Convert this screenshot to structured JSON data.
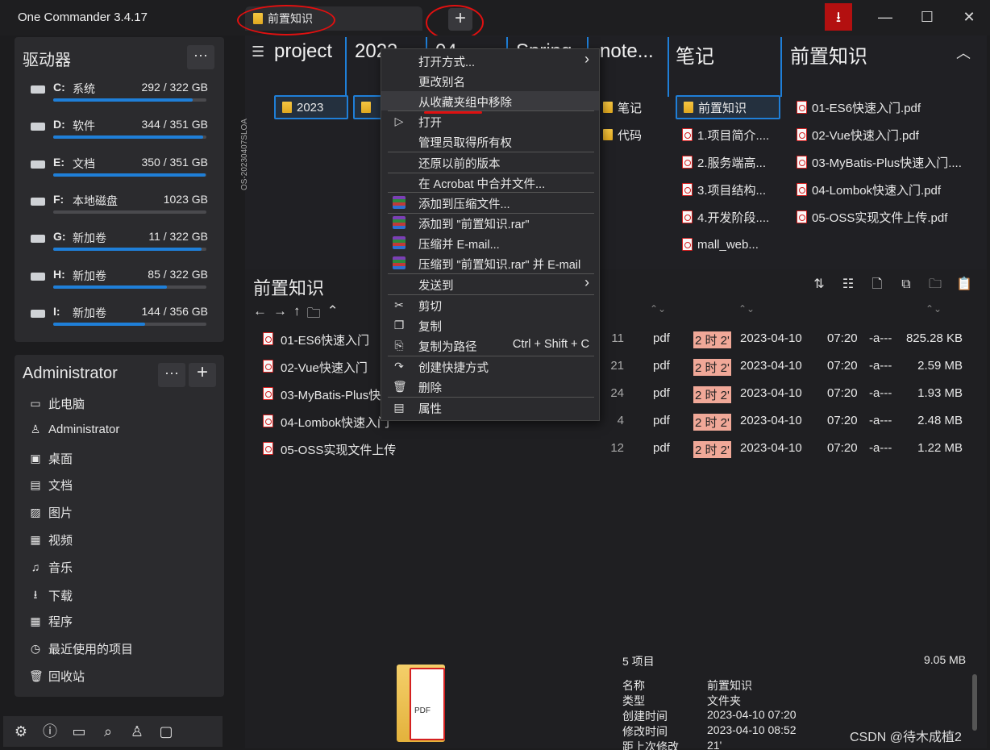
{
  "app": {
    "title": "One Commander 3.4.17"
  },
  "tab": {
    "label": "前置知识",
    "new_tab": "+"
  },
  "window": {
    "download": "⭳",
    "minimize": "—",
    "maximize": "☐",
    "close": "✕"
  },
  "drives_panel": {
    "title": "驱动器",
    "more": "···",
    "drives": [
      {
        "letter": "C:",
        "name": "系统",
        "used": "292",
        "total": "322 GB",
        "fill": 0.91
      },
      {
        "letter": "D:",
        "name": "软件",
        "used": "344",
        "total": "351 GB",
        "fill": 0.98
      },
      {
        "letter": "E:",
        "name": "文档",
        "used": "350",
        "total": "351 GB",
        "fill": 0.997
      },
      {
        "letter": "F:",
        "name": "本地磁盘",
        "used": "1023",
        "total": "GB",
        "fill": 0
      },
      {
        "letter": "G:",
        "name": "新加卷",
        "used": "11",
        "total": "322 GB",
        "fill": 0.97
      },
      {
        "letter": "H:",
        "name": "新加卷",
        "used": "85",
        "total": "322 GB",
        "fill": 0.74
      },
      {
        "letter": "I:",
        "name": "新加卷",
        "used": "144",
        "total": "356 GB",
        "fill": 0.6
      }
    ]
  },
  "admin_panel": {
    "title": "Administrator",
    "more": "···",
    "add": "+",
    "items": [
      "此电脑",
      "Administrator",
      "桌面",
      "文档",
      "图片",
      "视频",
      "音乐",
      "下载",
      "程序",
      "最近使用的项目",
      "回收站"
    ]
  },
  "columns": {
    "titles": [
      "project",
      "2023",
      "04",
      "Spring",
      "note...",
      "笔记",
      "前置知识"
    ],
    "col1_items": [
      "2023"
    ],
    "col5_items": [
      "笔记",
      "代码"
    ],
    "col6_items": [
      "前置知识",
      "1.项目简介....",
      "2.服务端高...",
      "3.项目结构...",
      "4.开发阶段....",
      "mall_web..."
    ],
    "col7_items": [
      "01-ES6快速入门.pdf",
      "02-Vue快速入门.pdf",
      "03-MyBatis-Plus快速入门....",
      "04-Lombok快速入门.pdf",
      "05-OSS实现文件上传.pdf"
    ],
    "vertical_label": "OS-20230407SLOA"
  },
  "context_menu": {
    "items": [
      {
        "label": "打开方式...",
        "arrow": "›"
      },
      {
        "label": "更改别名"
      },
      {
        "label": "从收藏夹组中移除"
      },
      {
        "label": "打开",
        "icon": "▷"
      },
      {
        "label": "管理员取得所有权"
      },
      {
        "label": "还原以前的版本"
      },
      {
        "label": "在 Acrobat 中合并文件..."
      },
      {
        "label": "添加到压缩文件..."
      },
      {
        "label": "添加到 \"前置知识.rar\""
      },
      {
        "label": "压缩并 E-mail..."
      },
      {
        "label": "压缩到 \"前置知识.rar\" 并 E-mail"
      },
      {
        "label": "发送到",
        "arrow": "›"
      },
      {
        "label": "剪切",
        "icon": "✂"
      },
      {
        "label": "复制",
        "icon": "❐"
      },
      {
        "label": "复制为路径",
        "shortcut": "Ctrl + Shift + C",
        "icon": "⎘"
      },
      {
        "label": "创建快捷方式",
        "icon": "↷"
      },
      {
        "label": "删除",
        "icon": "🗑"
      },
      {
        "label": "属性",
        "icon": "▤"
      }
    ]
  },
  "details": {
    "title": "前置知识",
    "rows": [
      {
        "name": "01-ES6快速入门",
        "num": "11",
        "type": "pdf",
        "age": "2 时 2'",
        "date": "2023-04-10",
        "time": "07:20",
        "attr": "-a---",
        "size": "825.28 KB"
      },
      {
        "name": "02-Vue快速入门",
        "num": "21",
        "type": "pdf",
        "age": "2 时 2'",
        "date": "2023-04-10",
        "time": "07:20",
        "attr": "-a---",
        "size": "2.59 MB"
      },
      {
        "name": "03-MyBatis-Plus快",
        "num": "24",
        "type": "pdf",
        "age": "2 时 2'",
        "date": "2023-04-10",
        "time": "07:20",
        "attr": "-a---",
        "size": "1.93 MB"
      },
      {
        "name": "04-Lombok快速入门",
        "num": "4",
        "type": "pdf",
        "age": "2 时 2'",
        "date": "2023-04-10",
        "time": "07:20",
        "attr": "-a---",
        "size": "2.48 MB"
      },
      {
        "name": "05-OSS实现文件上传",
        "num": "12",
        "type": "pdf",
        "age": "2 时 2'",
        "date": "2023-04-10",
        "time": "07:20",
        "attr": "-a---",
        "size": "1.22 MB"
      }
    ]
  },
  "info": {
    "count": "5 项目",
    "total": "9.05 MB",
    "labels": [
      "名称",
      "类型",
      "创建时间",
      "修改时间",
      "距上次修改"
    ],
    "values": [
      "前置知识",
      "文件夹",
      "2023-04-10  07:20",
      "2023-04-10  08:52",
      "21'"
    ]
  },
  "watermark": "CSDN @待木成植2",
  "colors": {
    "accent": "#1f7fd8",
    "annotation_red": "#e01010",
    "download_red": "#b31010"
  }
}
